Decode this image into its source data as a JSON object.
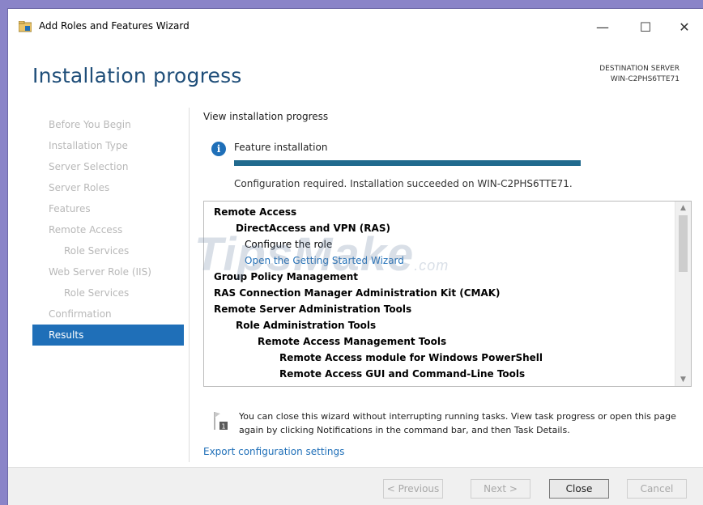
{
  "window": {
    "title": "Add Roles and Features Wizard",
    "min_glyph": "—",
    "max_glyph": "☐",
    "close_glyph": "✕"
  },
  "header": {
    "page_title": "Installation progress",
    "destination_label": "DESTINATION SERVER",
    "destination_server": "WIN-C2PHS6TTE71"
  },
  "nav": {
    "items": [
      {
        "label": "Before You Begin"
      },
      {
        "label": "Installation Type"
      },
      {
        "label": "Server Selection"
      },
      {
        "label": "Server Roles"
      },
      {
        "label": "Features"
      },
      {
        "label": "Remote Access"
      },
      {
        "label": "Role Services"
      },
      {
        "label": "Web Server Role (IIS)"
      },
      {
        "label": "Role Services"
      },
      {
        "label": "Confirmation"
      },
      {
        "label": "Results"
      }
    ]
  },
  "content": {
    "view_progress_label": "View installation progress",
    "info_glyph": "i",
    "feature_label": "Feature installation",
    "progress_fraction": 1.0,
    "status_text": "Configuration required. Installation succeeded on WIN-C2PHS6TTE71.",
    "results": [
      {
        "text": "Remote Access"
      },
      {
        "text": "DirectAccess and VPN (RAS)"
      },
      {
        "text": "Configure the role"
      },
      {
        "text": "Open the Getting Started Wizard"
      },
      {
        "text": "Group Policy Management"
      },
      {
        "text": "RAS Connection Manager Administration Kit (CMAK)"
      },
      {
        "text": "Remote Server Administration Tools"
      },
      {
        "text": "Role Administration Tools"
      },
      {
        "text": "Remote Access Management Tools"
      },
      {
        "text": "Remote Access module for Windows PowerShell"
      },
      {
        "text": "Remote Access GUI and Command-Line Tools"
      }
    ],
    "note_text": "You can close this wizard without interrupting running tasks. View task progress or open this page again by clicking Notifications in the command bar, and then Task Details.",
    "note_icon_badge": "1",
    "export_link": "Export configuration settings"
  },
  "footer": {
    "previous_label": "< Previous",
    "next_label": "Next >",
    "close_label": "Close",
    "cancel_label": "Cancel"
  },
  "watermark": {
    "text": "TipsMake",
    "suffix": ".com"
  },
  "colors": {
    "accent": "#1f6fb8",
    "title": "#1f4e79",
    "progress": "#216a8e"
  }
}
